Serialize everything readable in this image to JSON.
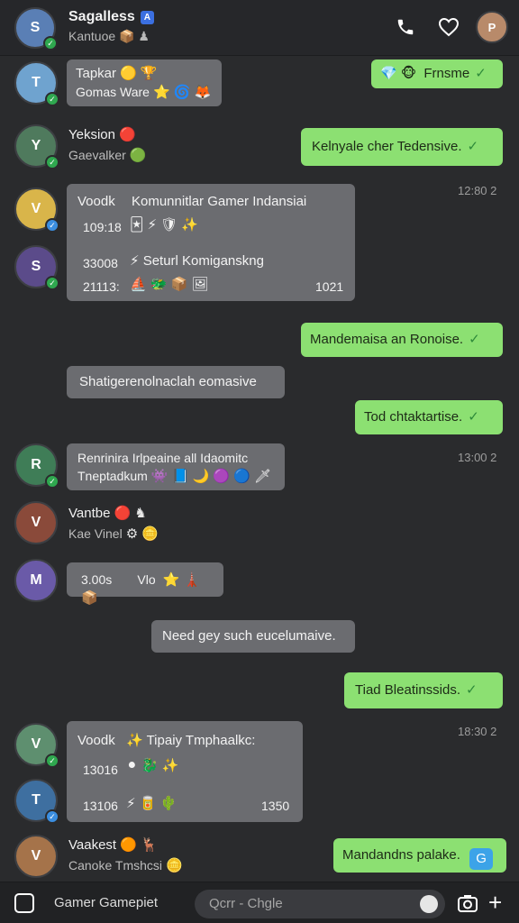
{
  "header": {
    "title": "Sagalless",
    "subtitle": "Kantuoe",
    "subtitle_emoji": "📦 ♟"
  },
  "messages": [
    {
      "name": "Tapkar",
      "line2": "Gomas Ware",
      "emoji1": "🟡 🏆",
      "emoji2": "⭐ 🌀 🦊"
    },
    {
      "name": "Yeksion",
      "line2": "Gaevalker",
      "emoji1": "🔴",
      "emoji2": "🟢"
    },
    {
      "col1": "Voodk",
      "title": "Komunnitlar Gamer Indansiai",
      "num1": "109:18",
      "emoji_row1": "🃏 ⚡ 🛡 ✨",
      "num2": "33008",
      "title2": "Seturl Komiganskng",
      "num3": "21113:",
      "emoji_row2": "⛵ 🐲 📦 🖼",
      "time": "1021"
    },
    {
      "label": "Shatigerenolnaclah eomasive"
    },
    {
      "line1": "Renrinira Irlpeaine all Idaomitc",
      "line2": "Tneptadkum",
      "emoji": "👾 📘 🌙 🟣 🔵 🗡"
    },
    {
      "name": "Vantbe",
      "line2": "Kae Vinel",
      "emoji1": "🔴 ♞",
      "emoji2": "⚙ 🪙"
    },
    {
      "num": "3.00s",
      "label": "Vlo",
      "emoji": "⭐ 🗼 📦"
    },
    {
      "label": "Need gey such eucelumaive."
    },
    {
      "col1": "Voodk",
      "title": "Tipaiy Tmphaalkc:",
      "num1": "13016",
      "emoji_row1": "⚫ 🐉 ✨",
      "num2": "13106",
      "emoji_row2": "⚡ 🥫 🌵",
      "time": "1350"
    },
    {
      "name": "Vaakest",
      "line2": "Canoke Tmshcsi",
      "emoji1": "🟠 🦌",
      "emoji2": "🪙"
    }
  ],
  "outgoing": [
    {
      "text": "Frnsme",
      "prefix": "💎 🐵"
    },
    {
      "text": "Kelnyale cher Tedensive."
    },
    {
      "text": "Mandemaisa an Ronoise."
    },
    {
      "text": "Tod chtaktartise."
    },
    {
      "text": "Tiad Bleatinssids."
    },
    {
      "text": "Mandandns palake."
    }
  ],
  "times": [
    "12:80 2",
    "13:00 2",
    "18:30 2"
  ],
  "bottom": {
    "left_label": "Gamer Gamepiet",
    "search_placeholder": "Qcrr - Chgle"
  },
  "colors": {
    "outgoing": "#8ce072",
    "incoming": "#6b6c70",
    "check": "#2fa84f"
  }
}
